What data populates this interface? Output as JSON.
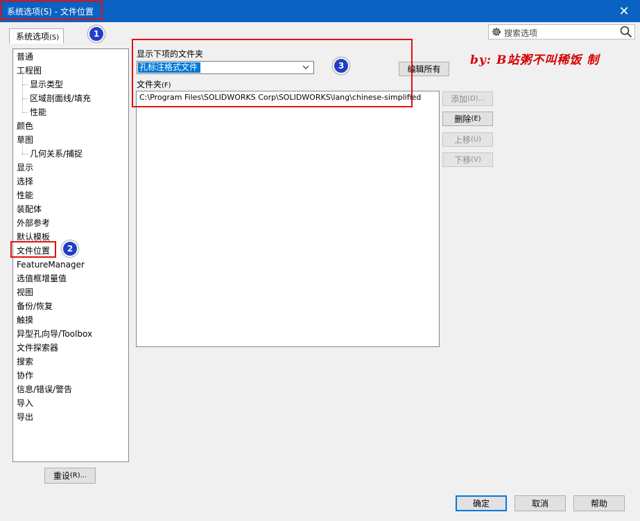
{
  "window": {
    "title": "系统选项(S) - 文件位置",
    "close": "✕"
  },
  "tab": {
    "label": "系统选项",
    "mnemonic": "(S)"
  },
  "badges": [
    "1",
    "2",
    "3"
  ],
  "search": {
    "placeholder": "搜索选项"
  },
  "tree": {
    "items": [
      {
        "label": "普通",
        "child": false
      },
      {
        "label": "工程图",
        "child": false
      },
      {
        "label": "显示类型",
        "child": true
      },
      {
        "label": "区域剖面线/填充",
        "child": true
      },
      {
        "label": "性能",
        "child": true
      },
      {
        "label": "颜色",
        "child": false
      },
      {
        "label": "草图",
        "child": false
      },
      {
        "label": "几何关系/捕捉",
        "child": true
      },
      {
        "label": "显示",
        "child": false
      },
      {
        "label": "选择",
        "child": false
      },
      {
        "label": "性能",
        "child": false
      },
      {
        "label": "装配体",
        "child": false
      },
      {
        "label": "外部参考",
        "child": false
      },
      {
        "label": "默认模板",
        "child": false
      },
      {
        "label": "文件位置",
        "child": false
      },
      {
        "label": "FeatureManager",
        "child": false
      },
      {
        "label": "选值框增量值",
        "child": false
      },
      {
        "label": "视图",
        "child": false
      },
      {
        "label": "备份/恢复",
        "child": false
      },
      {
        "label": "触摸",
        "child": false
      },
      {
        "label": "异型孔向导/Toolbox",
        "child": false
      },
      {
        "label": "文件探索器",
        "child": false
      },
      {
        "label": "搜索",
        "child": false
      },
      {
        "label": "协作",
        "child": false
      },
      {
        "label": "信息/错误/警告",
        "child": false
      },
      {
        "label": "导入",
        "child": false
      },
      {
        "label": "导出",
        "child": false
      }
    ]
  },
  "reset": {
    "label": "重设",
    "mnemonic": "(R)..."
  },
  "main": {
    "show_folders_label": "显示下项的文件夹",
    "folder_type_value": "孔标注格式文件",
    "edit_all_label": "编辑所有",
    "folders_label": "文件夹",
    "folders_mnemonic": "(F)",
    "folders": [
      "C:\\Program Files\\SOLIDWORKS Corp\\SOLIDWORKS\\lang\\chinese-simplified"
    ],
    "add": {
      "label": "添加",
      "mnemonic": "(D)..."
    },
    "delete": {
      "label": "删除",
      "mnemonic": "(E)"
    },
    "move_up": {
      "label": "上移",
      "mnemonic": "(U)"
    },
    "move_down": {
      "label": "下移",
      "mnemonic": "(V)"
    }
  },
  "watermark": "by: B站粥不叫稀饭 制",
  "footer": {
    "ok": "确定",
    "cancel": "取消",
    "help": "帮助"
  }
}
